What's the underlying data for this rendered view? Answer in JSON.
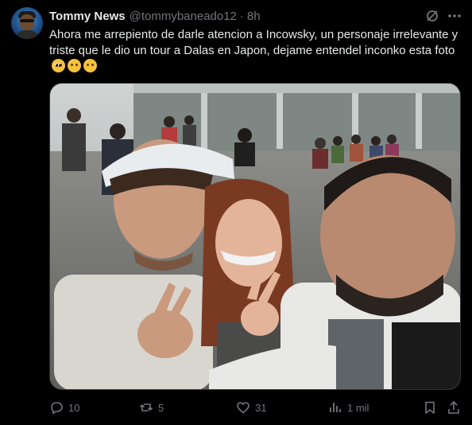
{
  "tweet": {
    "author_name": "Tommy News",
    "author_handle": "@tommybaneado12",
    "separator": "·",
    "time": "8h",
    "text": "Ahora me arrepiento de darle atencion a Incowsky, un personaje irrelevante y triste que le dio un tour a Dalas en Japon, dejame entendel inconko esta foto",
    "emojis": [
      "pleading-face-emoji",
      "relieved-face-emoji",
      "smirking-face-emoji"
    ]
  },
  "actions": {
    "replies": "10",
    "reposts": "5",
    "likes": "31",
    "views": "1 mil"
  },
  "icons": {
    "header": [
      "grok-icon",
      "more-icon"
    ],
    "actions": [
      "reply-icon",
      "repost-icon",
      "like-icon",
      "views-icon",
      "bookmark-icon",
      "share-icon"
    ]
  },
  "colors": {
    "background": "#000000",
    "text_primary": "#e7e9ea",
    "text_secondary": "#71767b",
    "border": "#2f3336"
  }
}
